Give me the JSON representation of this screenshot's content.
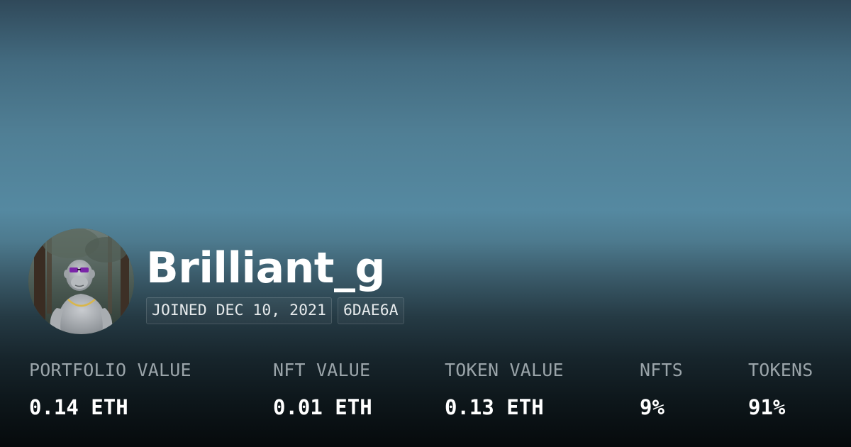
{
  "profile": {
    "username": "Brilliant_g",
    "joined": "JOINED DEC 10, 2021",
    "address_code": "6DAE6A",
    "avatar_icon": "ape-avatar"
  },
  "stats": [
    {
      "label": "PORTFOLIO VALUE",
      "value": "0.14 ETH"
    },
    {
      "label": "NFT VALUE",
      "value": "0.01 ETH"
    },
    {
      "label": "TOKEN VALUE",
      "value": "0.13 ETH"
    },
    {
      "label": "NFTS",
      "value": "9%"
    },
    {
      "label": "TOKENS",
      "value": "91%"
    }
  ],
  "colors": {
    "label_gray": "#9aa4a9",
    "value_white": "#ffffff",
    "background_top": "#30495a",
    "background_mid": "#5589a1",
    "background_bottom": "#060a0c"
  }
}
